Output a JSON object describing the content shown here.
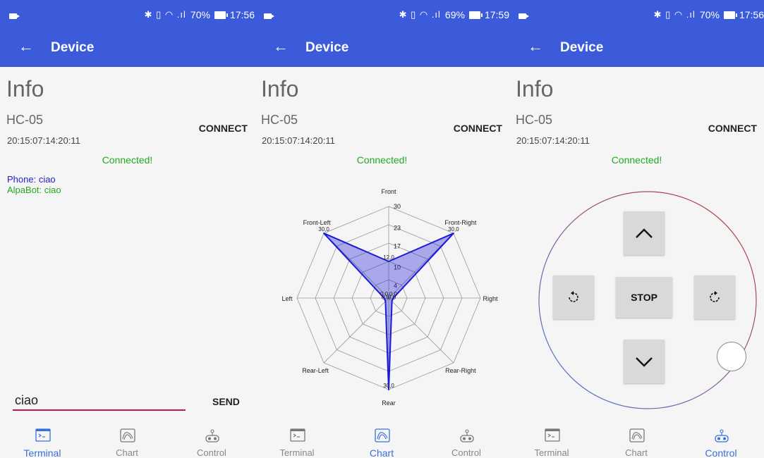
{
  "screens": [
    {
      "status": {
        "battery": "70%",
        "time": "17:56"
      },
      "appbar": {
        "title": "Device"
      },
      "info": {
        "heading": "Info",
        "name": "HC-05",
        "address": "20:15:07:14:20:11",
        "connect": "CONNECT",
        "status": "Connected!"
      },
      "terminal": {
        "messages": [
          "Phone: ciao",
          "AlpaBot: ciao"
        ],
        "input_value": "ciao",
        "send": "SEND"
      },
      "nav": [
        "Terminal",
        "Chart",
        "Control"
      ],
      "active_tab": "Terminal"
    },
    {
      "status": {
        "battery": "69%",
        "time": "17:59"
      },
      "appbar": {
        "title": "Device"
      },
      "info": {
        "heading": "Info",
        "name": "HC-05",
        "address": "20:15:07:14:20:11",
        "connect": "CONNECT",
        "status": "Connected!"
      },
      "nav": [
        "Terminal",
        "Chart",
        "Control"
      ],
      "active_tab": "Chart"
    },
    {
      "status": {
        "battery": "70%",
        "time": "17:56"
      },
      "appbar": {
        "title": "Device"
      },
      "info": {
        "heading": "Info",
        "name": "HC-05",
        "address": "20:15:07:14:20:11",
        "connect": "CONNECT",
        "status": "Connected!"
      },
      "control": {
        "stop": "STOP"
      },
      "nav": [
        "Terminal",
        "Chart",
        "Control"
      ],
      "active_tab": "Control"
    }
  ],
  "chart_data": {
    "type": "radar",
    "categories": [
      "Front",
      "Front-Right",
      "Right",
      "Rear-Right",
      "Rear",
      "Rear-Left",
      "Left",
      "Front-Left"
    ],
    "values": [
      12.0,
      30.0,
      0.0,
      0.0,
      30.0,
      0.0,
      0.0,
      30.0
    ],
    "value_labels": [
      "12,0",
      "30,0",
      "0,0",
      "0,0",
      "30,0",
      "0,0",
      "0,0",
      "30,0"
    ],
    "ticks": [
      "4",
      "10",
      "17",
      "23",
      "30"
    ],
    "rmax": 30,
    "color": "#1a1adb"
  },
  "colors": {
    "accent": "#3b5bdb",
    "connected": "#22aa22",
    "active_nav": "#3b6fd8"
  }
}
